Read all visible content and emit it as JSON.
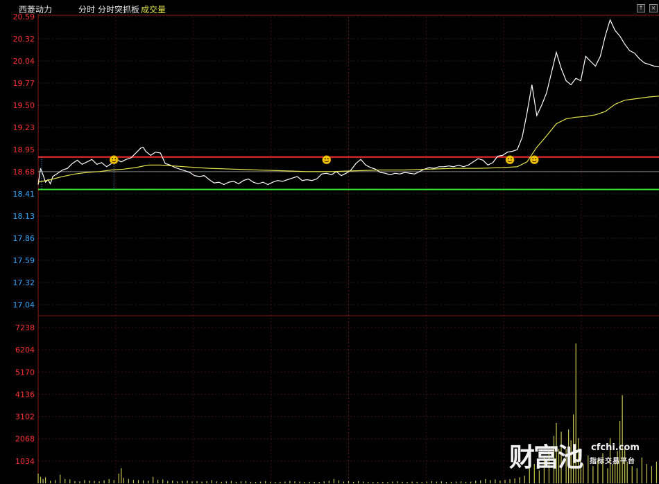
{
  "header": {
    "stock_name": "西菱动力",
    "mode": "分时",
    "indicator": "分时突抓板",
    "volume_label": "成交量"
  },
  "window_controls": {
    "up_icon": "up-arrow-icon",
    "close_icon": "close-icon"
  },
  "colors": {
    "background": "#000000",
    "price_line": "#ffffff",
    "avg_line": "#e6e64c",
    "upper_line": "#ff2b2b",
    "lower_line": "#33ee33",
    "axis_up": "#ff3232",
    "axis_down": "#33aaff",
    "volume_axis": "#ff3232",
    "volume_bar": "#c8c850",
    "grid": "#3a1a1a"
  },
  "watermark": {
    "logo_cn": "财富池",
    "site": "cfchi.com",
    "tagline": "指标交易平台"
  },
  "chart_data": {
    "type": "line",
    "price_axis_labels": [
      "20.59",
      "20.32",
      "20.04",
      "19.77",
      "19.50",
      "19.23",
      "18.95",
      "18.68",
      "18.41",
      "18.13",
      "17.86",
      "17.59",
      "17.32",
      "17.04"
    ],
    "price_axis_red": [
      "20.59",
      "20.32",
      "20.04",
      "19.77",
      "19.50",
      "19.23",
      "18.95",
      "18.68"
    ],
    "volume_axis_labels": [
      "7238",
      "6204",
      "5170",
      "4136",
      "3102",
      "2068",
      "1034"
    ],
    "ylim_price": [
      17.04,
      20.59
    ],
    "ylim_volume": [
      0,
      7238
    ],
    "xlim_minutes": [
      0,
      240
    ],
    "reference_lines": {
      "upper": 18.86,
      "lower": 18.46,
      "pre_close": 18.68
    },
    "series": [
      {
        "key": "price",
        "points": [
          [
            0,
            18.52
          ],
          [
            1,
            18.72
          ],
          [
            2,
            18.64
          ],
          [
            3,
            18.55
          ],
          [
            4,
            18.58
          ],
          [
            5,
            18.53
          ],
          [
            6,
            18.62
          ],
          [
            8,
            18.66
          ],
          [
            10,
            18.7
          ],
          [
            12,
            18.72
          ],
          [
            14,
            18.78
          ],
          [
            16,
            18.82
          ],
          [
            18,
            18.77
          ],
          [
            20,
            18.8
          ],
          [
            22,
            18.83
          ],
          [
            24,
            18.77
          ],
          [
            26,
            18.79
          ],
          [
            28,
            18.74
          ],
          [
            30,
            18.78
          ],
          [
            32,
            18.83
          ],
          [
            34,
            18.8
          ],
          [
            36,
            18.83
          ],
          [
            38,
            18.85
          ],
          [
            40,
            18.91
          ],
          [
            42,
            18.97
          ],
          [
            43,
            18.98
          ],
          [
            44,
            18.93
          ],
          [
            46,
            18.88
          ],
          [
            48,
            18.92
          ],
          [
            50,
            18.91
          ],
          [
            52,
            18.78
          ],
          [
            54,
            18.76
          ],
          [
            56,
            18.73
          ],
          [
            58,
            18.71
          ],
          [
            60,
            18.69
          ],
          [
            62,
            18.67
          ],
          [
            64,
            18.63
          ],
          [
            66,
            18.62
          ],
          [
            68,
            18.63
          ],
          [
            70,
            18.58
          ],
          [
            72,
            18.54
          ],
          [
            74,
            18.55
          ],
          [
            76,
            18.52
          ],
          [
            78,
            18.55
          ],
          [
            80,
            18.56
          ],
          [
            82,
            18.53
          ],
          [
            84,
            18.57
          ],
          [
            86,
            18.59
          ],
          [
            88,
            18.55
          ],
          [
            90,
            18.53
          ],
          [
            92,
            18.55
          ],
          [
            94,
            18.52
          ],
          [
            96,
            18.55
          ],
          [
            98,
            18.57
          ],
          [
            100,
            18.56
          ],
          [
            102,
            18.58
          ],
          [
            104,
            18.6
          ],
          [
            106,
            18.62
          ],
          [
            108,
            18.57
          ],
          [
            110,
            18.58
          ],
          [
            112,
            18.57
          ],
          [
            114,
            18.59
          ],
          [
            116,
            18.65
          ],
          [
            118,
            18.66
          ],
          [
            120,
            18.64
          ],
          [
            122,
            18.68
          ],
          [
            124,
            18.63
          ],
          [
            126,
            18.66
          ],
          [
            128,
            18.7
          ],
          [
            130,
            18.78
          ],
          [
            132,
            18.83
          ],
          [
            134,
            18.76
          ],
          [
            136,
            18.73
          ],
          [
            138,
            18.71
          ],
          [
            140,
            18.67
          ],
          [
            142,
            18.66
          ],
          [
            144,
            18.64
          ],
          [
            146,
            18.66
          ],
          [
            148,
            18.65
          ],
          [
            150,
            18.67
          ],
          [
            152,
            18.66
          ],
          [
            154,
            18.65
          ],
          [
            156,
            18.68
          ],
          [
            158,
            18.71
          ],
          [
            160,
            18.73
          ],
          [
            162,
            18.72
          ],
          [
            164,
            18.74
          ],
          [
            166,
            18.74
          ],
          [
            168,
            18.75
          ],
          [
            170,
            18.74
          ],
          [
            172,
            18.76
          ],
          [
            174,
            18.74
          ],
          [
            176,
            18.76
          ],
          [
            178,
            18.8
          ],
          [
            180,
            18.84
          ],
          [
            182,
            18.82
          ],
          [
            184,
            18.76
          ],
          [
            186,
            18.79
          ],
          [
            188,
            18.87
          ],
          [
            190,
            18.88
          ],
          [
            192,
            18.92
          ],
          [
            194,
            18.93
          ],
          [
            196,
            18.95
          ],
          [
            198,
            19.1
          ],
          [
            200,
            19.4
          ],
          [
            202,
            19.75
          ],
          [
            204,
            19.37
          ],
          [
            206,
            19.5
          ],
          [
            208,
            19.65
          ],
          [
            210,
            19.9
          ],
          [
            212,
            20.15
          ],
          [
            214,
            19.95
          ],
          [
            216,
            19.8
          ],
          [
            218,
            19.75
          ],
          [
            220,
            19.83
          ],
          [
            222,
            19.8
          ],
          [
            224,
            20.1
          ],
          [
            226,
            20.04
          ],
          [
            228,
            19.98
          ],
          [
            230,
            20.1
          ],
          [
            232,
            20.35
          ],
          [
            234,
            20.55
          ],
          [
            236,
            20.42
          ],
          [
            238,
            20.35
          ],
          [
            240,
            20.25
          ],
          [
            242,
            20.17
          ],
          [
            244,
            20.14
          ],
          [
            246,
            20.07
          ],
          [
            248,
            20.02
          ],
          [
            250,
            20.0
          ],
          [
            252,
            19.98
          ],
          [
            254,
            19.97
          ]
        ]
      },
      {
        "key": "average",
        "points": [
          [
            0,
            18.55
          ],
          [
            5,
            18.58
          ],
          [
            10,
            18.62
          ],
          [
            15,
            18.65
          ],
          [
            20,
            18.67
          ],
          [
            25,
            18.68
          ],
          [
            30,
            18.7
          ],
          [
            35,
            18.71
          ],
          [
            40,
            18.73
          ],
          [
            45,
            18.76
          ],
          [
            50,
            18.76
          ],
          [
            55,
            18.75
          ],
          [
            60,
            18.74
          ],
          [
            70,
            18.72
          ],
          [
            80,
            18.71
          ],
          [
            90,
            18.7
          ],
          [
            100,
            18.69
          ],
          [
            110,
            18.68
          ],
          [
            120,
            18.68
          ],
          [
            130,
            18.69
          ],
          [
            140,
            18.7
          ],
          [
            150,
            18.7
          ],
          [
            160,
            18.71
          ],
          [
            170,
            18.72
          ],
          [
            180,
            18.72
          ],
          [
            190,
            18.73
          ],
          [
            196,
            18.74
          ],
          [
            200,
            18.8
          ],
          [
            204,
            18.98
          ],
          [
            208,
            19.12
          ],
          [
            212,
            19.27
          ],
          [
            216,
            19.33
          ],
          [
            220,
            19.35
          ],
          [
            224,
            19.36
          ],
          [
            228,
            19.38
          ],
          [
            232,
            19.42
          ],
          [
            236,
            19.51
          ],
          [
            240,
            19.56
          ],
          [
            245,
            19.58
          ],
          [
            250,
            19.6
          ],
          [
            254,
            19.61
          ]
        ]
      }
    ],
    "signals_minutes": [
      31,
      118,
      193,
      203
    ],
    "volume": [
      [
        0,
        450
      ],
      [
        1,
        300
      ],
      [
        2,
        200
      ],
      [
        3,
        280
      ],
      [
        5,
        120
      ],
      [
        7,
        150
      ],
      [
        9,
        400
      ],
      [
        11,
        200
      ],
      [
        13,
        180
      ],
      [
        15,
        100
      ],
      [
        17,
        90
      ],
      [
        19,
        150
      ],
      [
        21,
        120
      ],
      [
        23,
        110
      ],
      [
        25,
        90
      ],
      [
        27,
        140
      ],
      [
        29,
        200
      ],
      [
        31,
        150
      ],
      [
        33,
        450
      ],
      [
        34,
        700
      ],
      [
        35,
        250
      ],
      [
        37,
        200
      ],
      [
        39,
        160
      ],
      [
        41,
        150
      ],
      [
        43,
        140
      ],
      [
        45,
        120
      ],
      [
        47,
        300
      ],
      [
        49,
        160
      ],
      [
        51,
        180
      ],
      [
        53,
        110
      ],
      [
        55,
        130
      ],
      [
        57,
        90
      ],
      [
        59,
        110
      ],
      [
        61,
        120
      ],
      [
        63,
        90
      ],
      [
        65,
        100
      ],
      [
        67,
        80
      ],
      [
        69,
        100
      ],
      [
        71,
        150
      ],
      [
        73,
        90
      ],
      [
        75,
        70
      ],
      [
        77,
        90
      ],
      [
        79,
        110
      ],
      [
        81,
        70
      ],
      [
        83,
        90
      ],
      [
        85,
        100
      ],
      [
        87,
        70
      ],
      [
        89,
        60
      ],
      [
        91,
        80
      ],
      [
        93,
        100
      ],
      [
        95,
        70
      ],
      [
        97,
        60
      ],
      [
        99,
        70
      ],
      [
        101,
        80
      ],
      [
        103,
        110
      ],
      [
        105,
        90
      ],
      [
        107,
        80
      ],
      [
        109,
        60
      ],
      [
        111,
        70
      ],
      [
        113,
        70
      ],
      [
        115,
        60
      ],
      [
        117,
        90
      ],
      [
        119,
        120
      ],
      [
        121,
        200
      ],
      [
        123,
        140
      ],
      [
        125,
        80
      ],
      [
        127,
        100
      ],
      [
        129,
        70
      ],
      [
        131,
        100
      ],
      [
        133,
        80
      ],
      [
        135,
        70
      ],
      [
        137,
        60
      ],
      [
        139,
        60
      ],
      [
        141,
        70
      ],
      [
        143,
        60
      ],
      [
        145,
        80
      ],
      [
        147,
        90
      ],
      [
        149,
        70
      ],
      [
        151,
        60
      ],
      [
        153,
        80
      ],
      [
        155,
        70
      ],
      [
        157,
        60
      ],
      [
        159,
        80
      ],
      [
        161,
        100
      ],
      [
        163,
        80
      ],
      [
        165,
        90
      ],
      [
        167,
        60
      ],
      [
        169,
        70
      ],
      [
        171,
        80
      ],
      [
        173,
        90
      ],
      [
        175,
        70
      ],
      [
        177,
        80
      ],
      [
        179,
        120
      ],
      [
        181,
        140
      ],
      [
        183,
        200
      ],
      [
        185,
        150
      ],
      [
        187,
        180
      ],
      [
        189,
        130
      ],
      [
        191,
        160
      ],
      [
        193,
        190
      ],
      [
        195,
        230
      ],
      [
        197,
        280
      ],
      [
        199,
        350
      ],
      [
        201,
        700
      ],
      [
        203,
        900
      ],
      [
        205,
        600
      ],
      [
        207,
        1200
      ],
      [
        209,
        1500
      ],
      [
        211,
        2200
      ],
      [
        212,
        2800
      ],
      [
        213,
        1600
      ],
      [
        214,
        2400
      ],
      [
        216,
        1600
      ],
      [
        217,
        2500
      ],
      [
        218,
        2000
      ],
      [
        219,
        3200
      ],
      [
        220,
        6500
      ],
      [
        221,
        2100
      ],
      [
        222,
        1500
      ],
      [
        223,
        900
      ],
      [
        225,
        1300
      ],
      [
        227,
        800
      ],
      [
        229,
        1100
      ],
      [
        231,
        1400
      ],
      [
        233,
        700
      ],
      [
        234,
        2100
      ],
      [
        235,
        900
      ],
      [
        236,
        1000
      ],
      [
        237,
        1500
      ],
      [
        238,
        2900
      ],
      [
        239,
        4100
      ],
      [
        240,
        1600
      ],
      [
        241,
        1000
      ],
      [
        243,
        800
      ],
      [
        245,
        700
      ],
      [
        247,
        1200
      ],
      [
        249,
        900
      ],
      [
        251,
        800
      ],
      [
        253,
        1000
      ]
    ]
  }
}
